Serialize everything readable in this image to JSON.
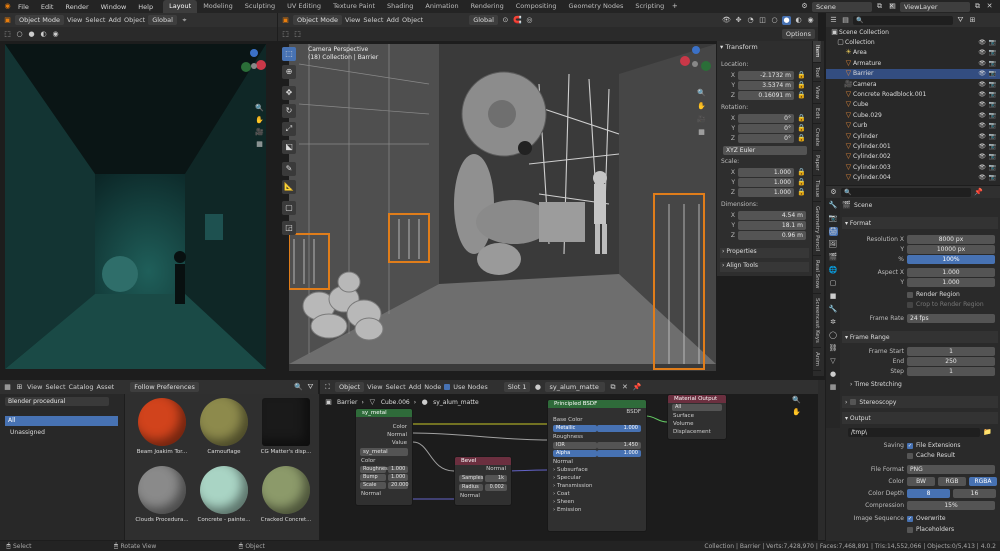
{
  "topbar": {
    "menus": [
      "File",
      "Edit",
      "Render",
      "Window",
      "Help"
    ],
    "workspaces": [
      "Layout",
      "Modeling",
      "Sculpting",
      "UV Editing",
      "Texture Paint",
      "Shading",
      "Animation",
      "Rendering",
      "Compositing",
      "Geometry Nodes",
      "Scripting"
    ],
    "active_workspace": "Layout",
    "scene": "Scene",
    "view_layer": "ViewLayer"
  },
  "left_viewport": {
    "mode": "Object Mode",
    "menus": [
      "View",
      "Select",
      "Add",
      "Object"
    ],
    "orientation": "Global"
  },
  "main_viewport": {
    "mode": "Object Mode",
    "menus": [
      "View",
      "Select",
      "Add",
      "Object"
    ],
    "orientation": "Global",
    "options": "Options",
    "info_line1": "Camera Perspective",
    "info_line2": "(18) Collection | Barrier"
  },
  "n_panel": {
    "transform_title": "Transform",
    "location_label": "Location:",
    "loc_x": "-2.1732 m",
    "loc_y": "3.5374 m",
    "loc_z": "0.16091 m",
    "rotation_label": "Rotation:",
    "rot_x": "0°",
    "rot_y": "0°",
    "rot_z": "0°",
    "rot_mode": "XYZ Euler",
    "scale_label": "Scale:",
    "sc_x": "1.000",
    "sc_y": "1.000",
    "sc_z": "1.000",
    "dimensions_label": "Dimensions:",
    "dim_x": "4.54 m",
    "dim_y": "18.1 m",
    "dim_z": "0.96 m",
    "axis_x": "X",
    "axis_y": "Y",
    "axis_z": "Z",
    "properties": "Properties",
    "align_tools": "Align Tools",
    "tabs": [
      "Item",
      "Tool",
      "View",
      "Edit",
      "Create",
      "Paper",
      "Tissue",
      "Geometry Pencil",
      "Real Snow",
      "Screencast Keys",
      "Anim"
    ]
  },
  "outliner": {
    "scene_collection": "Scene Collection",
    "collection": "Collection",
    "items": [
      {
        "name": "Area",
        "sel": false
      },
      {
        "name": "Armature",
        "sel": false
      },
      {
        "name": "Barrier",
        "sel": true
      },
      {
        "name": "Camera",
        "sel": false
      },
      {
        "name": "Concrete Roadblock.001",
        "sel": false
      },
      {
        "name": "Cube",
        "sel": false
      },
      {
        "name": "Cube.029",
        "sel": false
      },
      {
        "name": "Curb",
        "sel": false
      },
      {
        "name": "Cylinder",
        "sel": false
      },
      {
        "name": "Cylinder.001",
        "sel": false
      },
      {
        "name": "Cylinder.002",
        "sel": false
      },
      {
        "name": "Cylinder.003",
        "sel": false
      },
      {
        "name": "Cylinder.004",
        "sel": false
      }
    ]
  },
  "properties": {
    "scene": "Scene",
    "format": "Format",
    "res_x_label": "Resolution X",
    "res_x": "8000 px",
    "res_y_label": "Y",
    "res_y": "10000 px",
    "pct_label": "%",
    "pct": "100%",
    "aspect_x_label": "Aspect X",
    "aspect_x": "1.000",
    "aspect_y_label": "Y",
    "aspect_y": "1.000",
    "render_region": "Render Region",
    "crop": "Crop to Render Region",
    "frame_rate_label": "Frame Rate",
    "frame_rate": "24 fps",
    "frame_range": "Frame Range",
    "frame_start_label": "Frame Start",
    "frame_start": "1",
    "end_label": "End",
    "end": "250",
    "step_label": "Step",
    "step": "1",
    "time_stretching": "Time Stretching",
    "stereoscopy": "Stereoscopy",
    "output": "Output",
    "path": "/tmp\\",
    "saving_label": "Saving",
    "file_ext": "File Extensions",
    "cache": "Cache Result",
    "file_format_label": "File Format",
    "file_format": "PNG",
    "color_label": "Color",
    "bw": "BW",
    "rgb": "RGB",
    "rgba": "RGBA",
    "color_depth_label": "Color Depth",
    "depth8": "8",
    "depth16": "16",
    "compression_label": "Compression",
    "compression": "15%",
    "image_seq_label": "Image Sequence",
    "overwrite": "Overwrite",
    "placeholders": "Placeholders"
  },
  "asset_browser": {
    "menus": [
      "View",
      "Select",
      "Catalog",
      "Asset"
    ],
    "follow": "Follow Preferences",
    "library": "Blender procedural",
    "all": "All",
    "unassigned": "Unassigned",
    "assets": [
      {
        "name": "Beam Joakim Tor...",
        "color": "#d1431c"
      },
      {
        "name": "Camouflage",
        "color": "#8d8a4c"
      },
      {
        "name": "CG Matter's disp...",
        "color": "#1a1a1a"
      },
      {
        "name": "Clouds Procedura...",
        "color": "#8a8a8a"
      },
      {
        "name": "Concrete - painte...",
        "color": "#a9d4c4"
      },
      {
        "name": "Cracked Concret...",
        "color": "#8c9a6a"
      }
    ]
  },
  "node_editor": {
    "object": "Object",
    "menus": [
      "View",
      "Select",
      "Add",
      "Node"
    ],
    "use_nodes": "Use Nodes",
    "slot": "Slot 1",
    "material": "sy_alum_matte",
    "crumb_barrier": "Barrier",
    "crumb_cube": "Cube.006",
    "crumb_mat": "sy_alum_matte",
    "n1": {
      "title": "sy_metal",
      "color": "Color",
      "normal": "Normal",
      "value": "Value",
      "rough": "Roughnes",
      "rough_v": "1.000",
      "bump": "Bump",
      "bump_v": "1.000",
      "scale": "Scale",
      "scale_v": "20.000",
      "normal2": "Normal",
      "tex": "sy_metal"
    },
    "n2": {
      "title": "Bevel",
      "samples": "Samples",
      "samples_v": "1k",
      "radius": "Radius",
      "radius_v": "0.002",
      "normal": "Normal"
    },
    "n3": {
      "title": "Principled BSDF",
      "bsdf": "BSDF",
      "base": "Base Color",
      "metallic": "Metallic",
      "metallic_v": "1.000",
      "rough": "Roughness",
      "ior": "IOR",
      "ior_v": "1.450",
      "alpha": "Alpha",
      "alpha_v": "1.000",
      "normal": "Normal",
      "subsurface": "Subsurface",
      "specular": "Specular",
      "transmission": "Transmission",
      "coat": "Coat",
      "sheen": "Sheen",
      "emission": "Emission"
    },
    "n4": {
      "title": "Material Output",
      "target": "All",
      "surface": "Surface",
      "volume": "Volume",
      "displacement": "Displacement"
    }
  },
  "statusbar": {
    "select": "Select",
    "rotate": "Rotate View",
    "object": "Object",
    "stats": "Collection | Barrier | Verts:7,428,970 | Faces:7,468,891 | Tris:14,552,066 | Objects:0/5,413 | 4.0.2"
  }
}
